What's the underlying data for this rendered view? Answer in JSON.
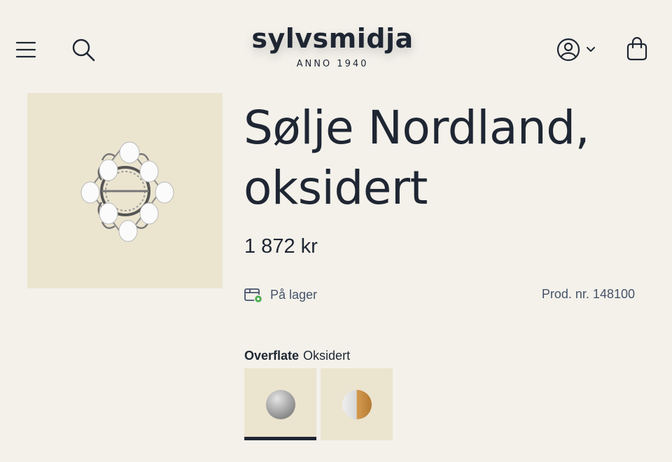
{
  "brand": {
    "name": "sylvsmidja",
    "tagline": "ANNO 1940"
  },
  "header": {
    "icons": [
      "menu-icon",
      "search-icon",
      "account-icon",
      "chevron-down-icon",
      "shopping-bag-icon"
    ]
  },
  "product": {
    "title_line1": "Sølje Nordland,",
    "title_line2": "oksidert",
    "price": "1 872 kr",
    "stock": "På lager",
    "product_number": "Prod. nr. 148100",
    "image_icon": "brooch-image"
  },
  "finish": {
    "label": "Overflate",
    "selected": "Oksidert",
    "options": [
      "silver-oxidized-swatch",
      "silver-gold-swatch"
    ]
  },
  "colors": {
    "background": "#f3f1ea",
    "panel": "#ebe4cf",
    "text": "#1f2633",
    "muted": "#46536a",
    "stock_dot": "#4caf50"
  }
}
